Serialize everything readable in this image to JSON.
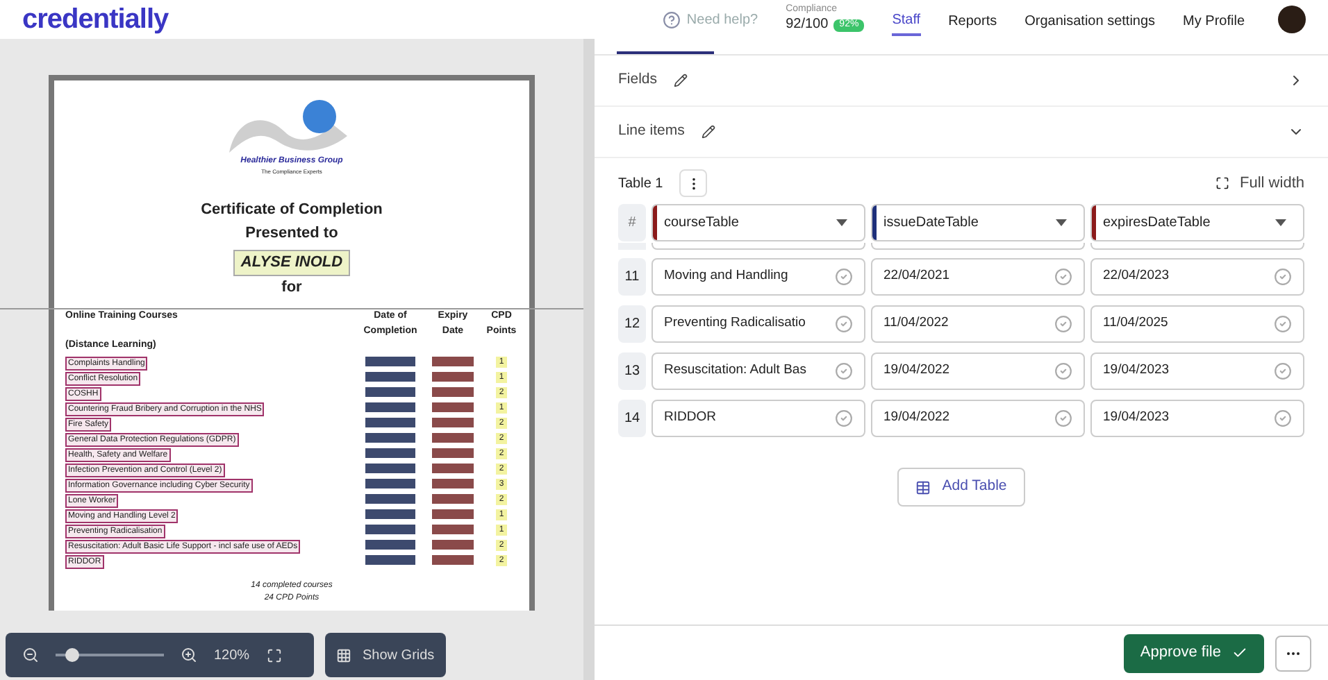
{
  "header": {
    "logo": "credentially",
    "help": "Need help?",
    "compliance_label": "Compliance",
    "compliance_score": "92/100",
    "compliance_badge": "92%",
    "nav": [
      {
        "label": "Staff",
        "selected": true
      },
      {
        "label": "Reports",
        "selected": false
      },
      {
        "label": "Organisation settings",
        "selected": false
      },
      {
        "label": "My Profile",
        "selected": false
      }
    ]
  },
  "document": {
    "logo_name": "Healthier Business Group",
    "logo_tagline": "The Compliance Experts",
    "title": "Certificate of Completion",
    "subtitle": "Presented to",
    "recipient": "ALYSE INOLD",
    "for": "for",
    "columns": [
      "Online Training Courses",
      "Date of Completion",
      "Expiry Date",
      "CPD Points"
    ],
    "columns_sub": "(Distance Learning)",
    "courses": [
      {
        "name": "Complaints Handling",
        "points": "1"
      },
      {
        "name": "Conflict Resolution",
        "points": "1"
      },
      {
        "name": "COSHH",
        "points": "2"
      },
      {
        "name": "Countering Fraud Bribery and Corruption in the NHS",
        "points": "1"
      },
      {
        "name": "Fire Safety",
        "points": "2"
      },
      {
        "name": "General Data Protection Regulations (GDPR)",
        "points": "2"
      },
      {
        "name": "Health, Safety and Welfare",
        "points": "2"
      },
      {
        "name": "Infection Prevention and Control (Level 2)",
        "points": "2"
      },
      {
        "name": "Information Governance including Cyber Security",
        "points": "3"
      },
      {
        "name": "Lone Worker",
        "points": "2"
      },
      {
        "name": "Moving and Handling Level 2",
        "points": "1"
      },
      {
        "name": "Preventing Radicalisation",
        "points": "1"
      },
      {
        "name": "Resuscitation: Adult Basic Life Support - incl safe use of AEDs",
        "points": "2"
      },
      {
        "name": "RIDDOR",
        "points": "2"
      }
    ],
    "summary": [
      "14 completed courses",
      "24 CPD Points"
    ]
  },
  "viewer_toolbar": {
    "level": 0.15,
    "zoom": "120%",
    "show_grids": "Show Grids"
  },
  "sections": [
    {
      "title": "Fields",
      "expanded": false
    },
    {
      "title": "Line items",
      "expanded": true
    }
  ],
  "table": {
    "title": "Table 1",
    "full_width": "Full width",
    "index_header": "#",
    "columns": [
      {
        "name": "courseTable",
        "color": "#8b1a1a"
      },
      {
        "name": "issueDateTable",
        "color": "#1e2f7a"
      },
      {
        "name": "expiresDateTable",
        "color": "#8b1a1a"
      }
    ],
    "rows": [
      {
        "index": "11",
        "cells": [
          "Moving and Handling",
          "22/04/2021",
          "22/04/2023"
        ]
      },
      {
        "index": "12",
        "cells": [
          "Preventing Radicalisatio",
          "11/04/2022",
          "11/04/2025"
        ]
      },
      {
        "index": "13",
        "cells": [
          "Resuscitation: Adult Bas",
          "19/04/2022",
          "19/04/2023"
        ]
      },
      {
        "index": "14",
        "cells": [
          "RIDDOR",
          "19/04/2022",
          "19/04/2023"
        ]
      }
    ],
    "add_table": "Add Table"
  },
  "footer": {
    "approve": "Approve file"
  }
}
